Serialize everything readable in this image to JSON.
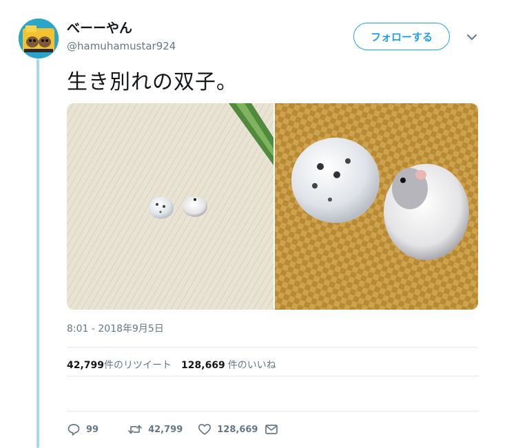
{
  "user": {
    "display_name": "べーーやん",
    "handle": "@hamuhamustar924"
  },
  "follow_label": "フォローする",
  "tweet": {
    "text": "生き別れの双子。",
    "timestamp": "8:01 - 2018年9月5日"
  },
  "stats": {
    "retweets_count": "42,799",
    "retweets_label": "件のリツイート",
    "likes_count": "128,669",
    "likes_label": "件のいいね"
  },
  "actions": {
    "reply_count": "99",
    "retweet_count": "42,799",
    "like_count": "128,669"
  },
  "icons": {
    "reply": "reply-icon",
    "retweet": "retweet-icon",
    "like": "heart-icon",
    "dm": "envelope-icon",
    "caret": "chevron-down-icon"
  },
  "colors": {
    "accent": "#1da1f2",
    "thread_line": "#a6d6f5",
    "secondary_text": "#657786"
  }
}
